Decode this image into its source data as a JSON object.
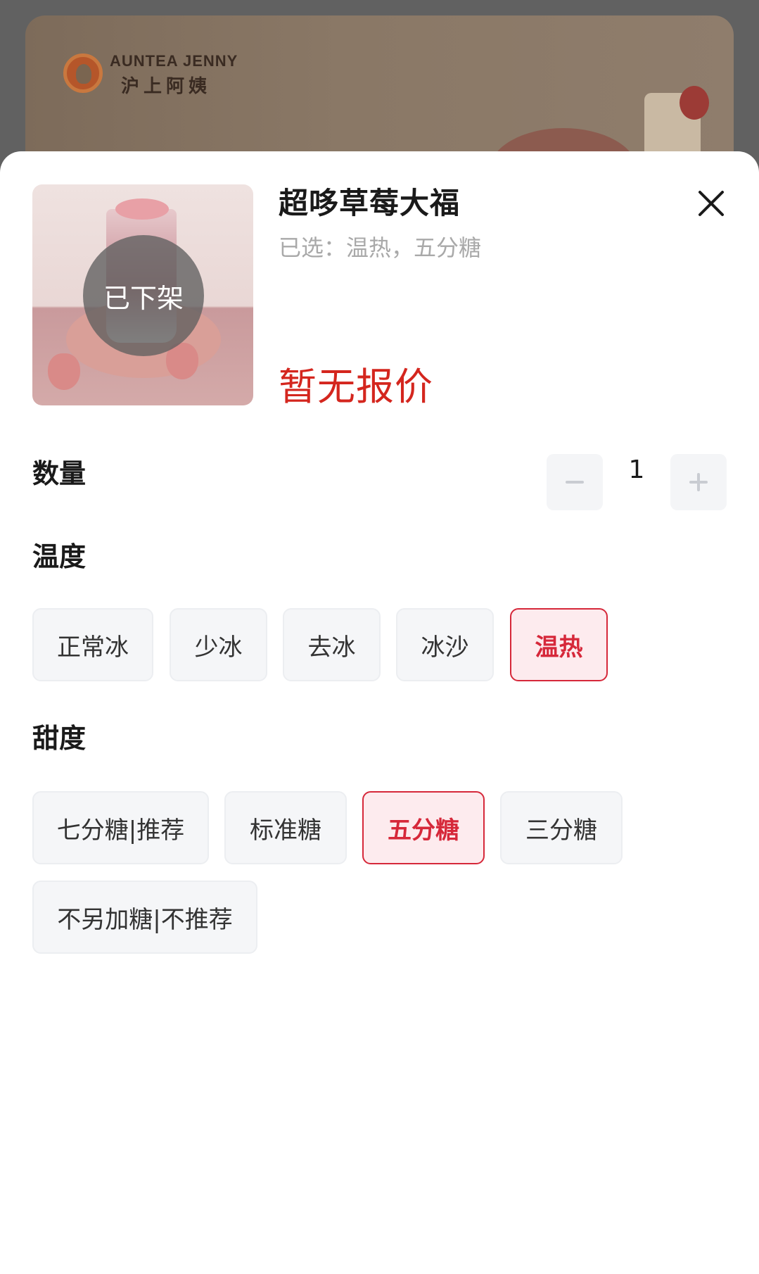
{
  "brand": {
    "name_en": "AUNTEA JENNY",
    "name_cn": "沪上阿姨"
  },
  "product": {
    "name": "超哆草莓大福",
    "selected_summary": "已选：温热，五分糖",
    "status_badge": "已下架",
    "price_text": "暂无报价"
  },
  "quantity": {
    "label": "数量",
    "value": "1"
  },
  "temperature": {
    "label": "温度",
    "options": [
      "正常冰",
      "少冰",
      "去冰",
      "冰沙",
      "温热"
    ],
    "selected": "温热"
  },
  "sweetness": {
    "label": "甜度",
    "options": [
      "七分糖|推荐",
      "标准糖",
      "五分糖",
      "三分糖",
      "不另加糖|不推荐"
    ],
    "selected": "五分糖"
  },
  "icons": {
    "close": "close-icon",
    "minus": "minus-icon",
    "plus": "plus-icon"
  },
  "colors": {
    "accent": "#d6283a",
    "price": "#d4261e",
    "chip_bg": "#f5f6f8",
    "chip_selected_bg": "#fdebee"
  }
}
